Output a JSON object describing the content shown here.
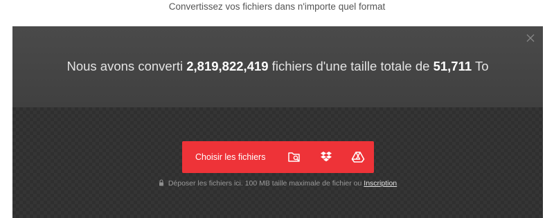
{
  "header": {
    "subtitle": "Convertissez vos fichiers dans n'importe quel format"
  },
  "stats": {
    "prefix": "Nous avons converti",
    "files_count": "2,819,822,419",
    "middle": "fichiers d'une taille totale de",
    "total_size": "51,711",
    "unit": "To"
  },
  "upload": {
    "choose_files_label": "Choisir les fichiers",
    "icons": [
      "folder-search-icon",
      "dropbox-icon",
      "google-drive-icon"
    ]
  },
  "note": {
    "text": "Déposer les fichiers ici. 100 MB taille maximale de fichier ou",
    "link": "Inscription"
  },
  "colors": {
    "accent": "#ee3338",
    "panel_top": "#464646",
    "panel_bottom": "#2f2f2f"
  }
}
